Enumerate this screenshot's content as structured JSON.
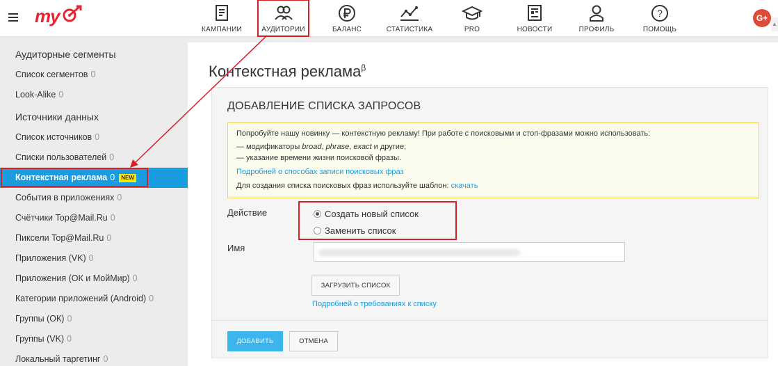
{
  "app": {
    "logo": "my"
  },
  "nav": [
    {
      "label": "КАМПАНИИ",
      "icon": "campaigns-icon",
      "active": false
    },
    {
      "label": "АУДИТОРИИ",
      "icon": "audiences-icon",
      "active": true
    },
    {
      "label": "БАЛАНС",
      "icon": "ruble-icon",
      "active": false
    },
    {
      "label": "СТАТИСТИКА",
      "icon": "chart-icon",
      "active": false
    },
    {
      "label": "PRO",
      "icon": "graduation-cap-icon",
      "active": false
    },
    {
      "label": "НОВОСТИ",
      "icon": "news-icon",
      "active": false
    },
    {
      "label": "ПРОФИЛЬ",
      "icon": "user-icon",
      "active": false
    },
    {
      "label": "ПОМОЩЬ",
      "icon": "help-icon",
      "active": false
    }
  ],
  "social": {
    "gplus": "G+"
  },
  "sidebar": {
    "groups": [
      "Аудиторные сегменты",
      "Источники данных"
    ],
    "items": [
      {
        "label": "Список сегментов",
        "count": "0"
      },
      {
        "label": "Look-Alike",
        "count": "0"
      },
      {
        "label": "Список источников",
        "count": "0"
      },
      {
        "label": "Списки пользователей",
        "count": "0"
      },
      {
        "label": "Контекстная реклама",
        "count": "0",
        "badge": "NEW",
        "active": true
      },
      {
        "label": "События в приложениях",
        "count": "0"
      },
      {
        "label": "Счётчики Top@Mail.Ru",
        "count": "0"
      },
      {
        "label": "Пиксели Top@Mail.Ru",
        "count": "0"
      },
      {
        "label": "Приложения (VK)",
        "count": "0"
      },
      {
        "label": "Приложения (ОК и МойМир)",
        "count": "0"
      },
      {
        "label": "Категории приложений (Android)",
        "count": "0"
      },
      {
        "label": "Группы (ОК)",
        "count": "0"
      },
      {
        "label": "Группы (VK)",
        "count": "0"
      },
      {
        "label": "Локальный таргетинг",
        "count": "0"
      }
    ]
  },
  "main": {
    "title": "Контекстная реклама",
    "title_sup": "β",
    "card_title": "ДОБАВЛЕНИЕ СПИСКА ЗАПРОСОВ",
    "info": {
      "line1": "Попробуйте нашу новинку — контекстную рекламу! При работе с поисковыми и стоп-фразами можно использовать:",
      "line2_prefix": "— модификаторы ",
      "line2_broad": "broad",
      "line2_sep1": ", ",
      "line2_phrase": "phrase",
      "line2_sep2": ", ",
      "line2_exact": "exact",
      "line2_suffix": " и другие;",
      "line3": "— указание времени жизни поисковой фразы.",
      "link1": "Подробней о способах записи поисковых фраз",
      "line4": "Для создания списка поисковых фраз используйте шаблон: ",
      "link2": "скачать"
    },
    "action_label": "Действие",
    "radio_create": "Создать новый список",
    "radio_replace": "Заменить список",
    "name_label": "Имя",
    "name_value": "",
    "upload_button": "ЗАГРУЗИТЬ СПИСОК",
    "requirements_link": "Подробней о требованиях к списку",
    "add_button": "ДОБАВИТЬ",
    "cancel_button": "ОТМЕНА"
  },
  "colors": {
    "accent": "#1a9de0",
    "brand": "#e8232f",
    "annotation": "#d62027"
  }
}
